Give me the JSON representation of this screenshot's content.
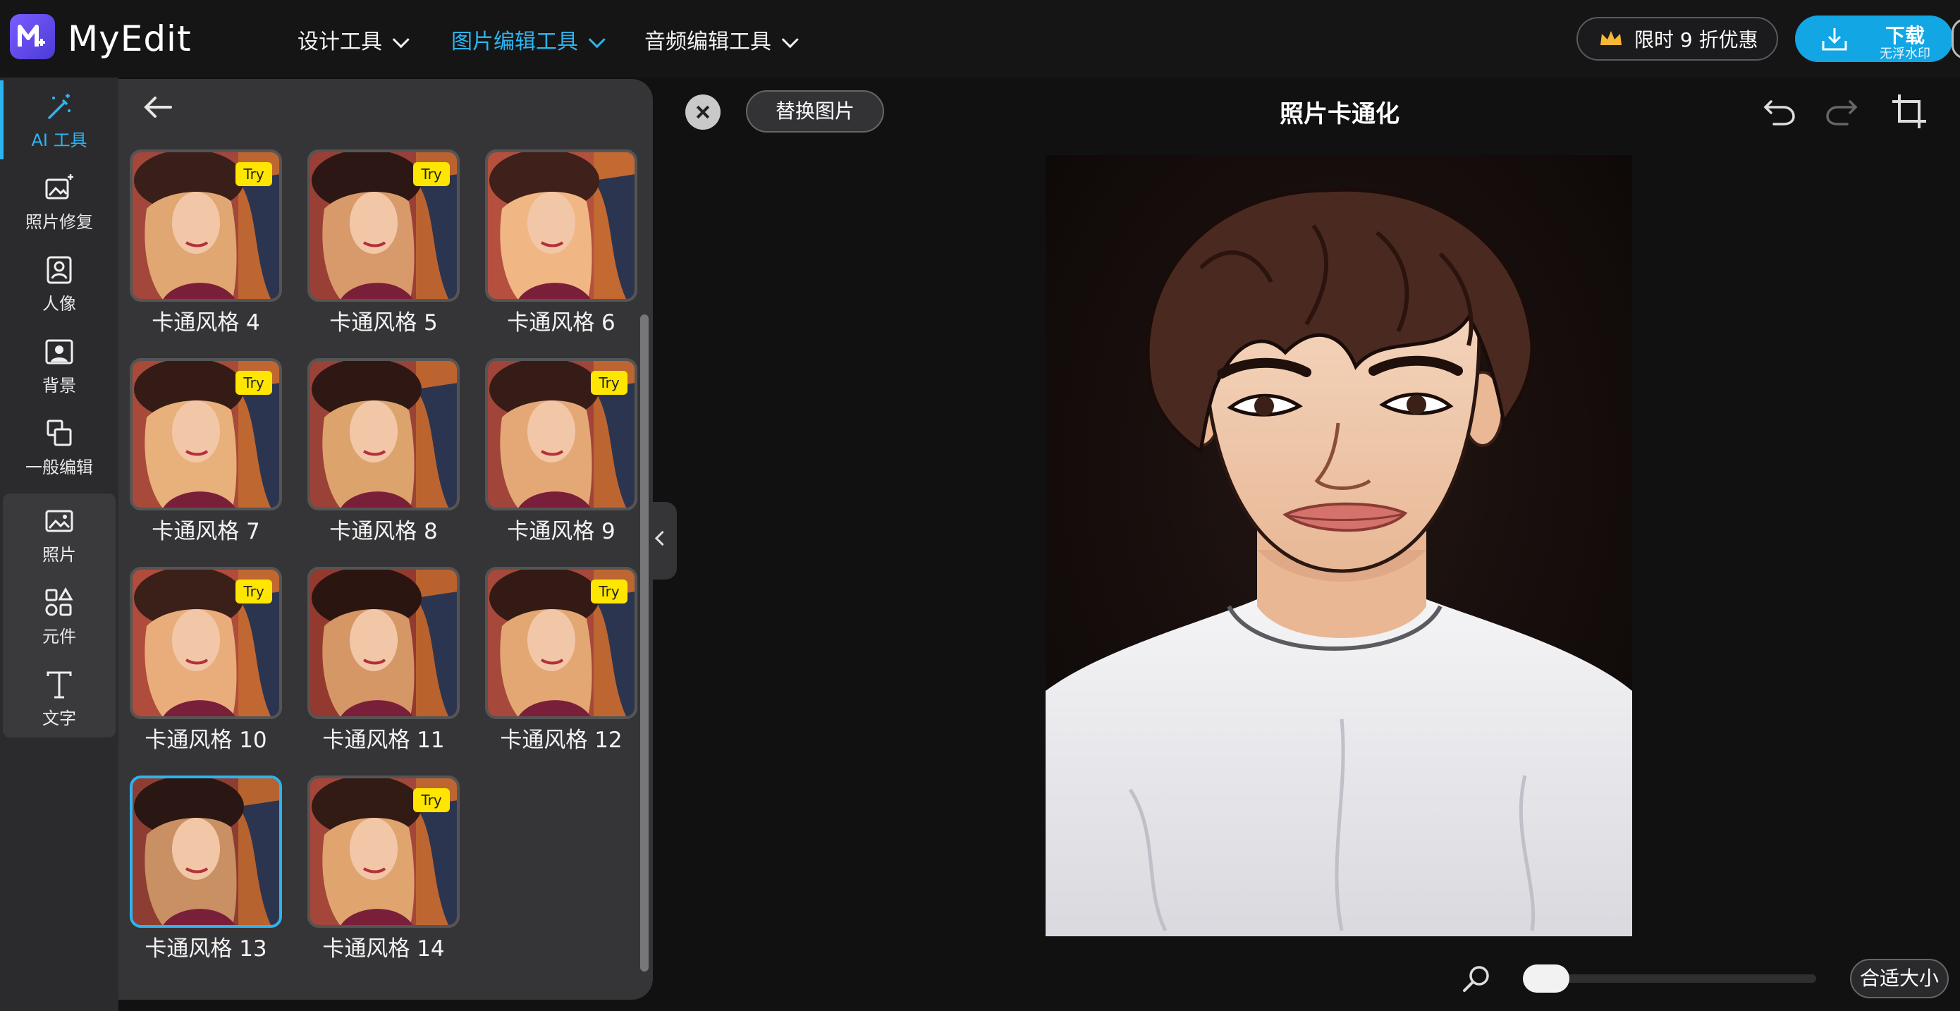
{
  "app": {
    "name": "MyEdit"
  },
  "nav": {
    "items": [
      {
        "label": "设计工具",
        "active": false
      },
      {
        "label": "图片编辑工具",
        "active": true
      },
      {
        "label": "音频编辑工具",
        "active": false
      }
    ],
    "promo_label": "限时 9 折优惠",
    "download_label": "下载",
    "download_sub": "无浮水印"
  },
  "rail": {
    "items": [
      {
        "label": "AI 工具",
        "icon": "magic-wand-icon",
        "active": true
      },
      {
        "label": "照片修复",
        "icon": "image-sparkle-icon",
        "active": false
      },
      {
        "label": "人像",
        "icon": "portrait-icon",
        "active": false
      },
      {
        "label": "背景",
        "icon": "background-icon",
        "active": false
      },
      {
        "label": "一般编辑",
        "icon": "layers-icon",
        "active": false
      },
      {
        "label": "照片",
        "icon": "photo-icon",
        "active": false
      },
      {
        "label": "元件",
        "icon": "shapes-icon",
        "active": false
      },
      {
        "label": "文字",
        "icon": "text-icon",
        "active": false
      }
    ]
  },
  "panel": {
    "try_badge": "Try",
    "styles": [
      {
        "label": "卡通风格 4",
        "try": true,
        "selected": false
      },
      {
        "label": "卡通风格 5",
        "try": true,
        "selected": false
      },
      {
        "label": "卡通风格 6",
        "try": false,
        "selected": false
      },
      {
        "label": "卡通风格 7",
        "try": true,
        "selected": false
      },
      {
        "label": "卡通风格 8",
        "try": false,
        "selected": false
      },
      {
        "label": "卡通风格 9",
        "try": true,
        "selected": false
      },
      {
        "label": "卡通风格 10",
        "try": true,
        "selected": false
      },
      {
        "label": "卡通风格 11",
        "try": false,
        "selected": false
      },
      {
        "label": "卡通风格 12",
        "try": true,
        "selected": false
      },
      {
        "label": "卡通风格 13",
        "try": false,
        "selected": true
      },
      {
        "label": "卡通风格 14",
        "try": true,
        "selected": false
      }
    ]
  },
  "canvas": {
    "replace_label": "替换图片",
    "title": "照片卡通化",
    "fit_label": "合适大小",
    "zoom_level": 0
  },
  "colors": {
    "accent": "#2db4ef",
    "try_badge": "#ffe600",
    "brand": "#5b45e8"
  }
}
